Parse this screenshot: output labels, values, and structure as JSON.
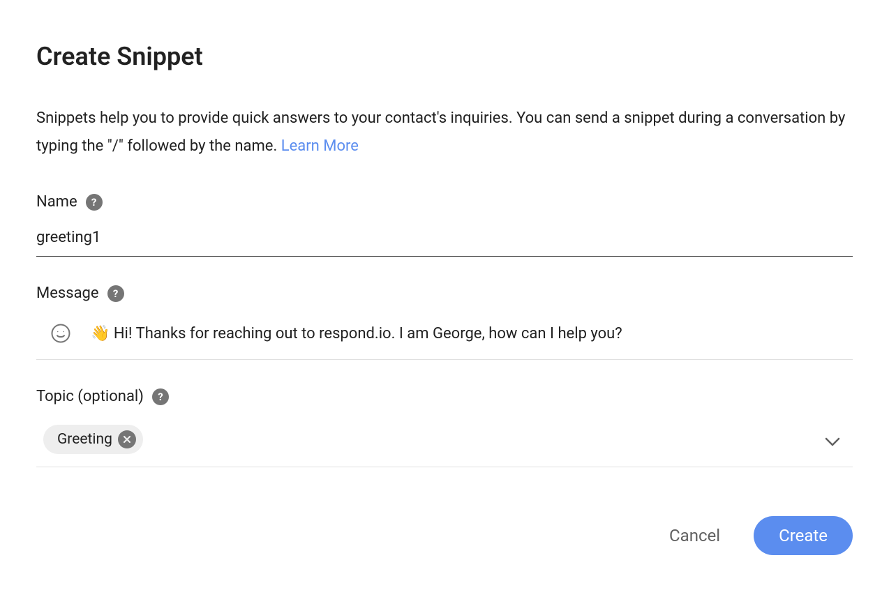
{
  "header": {
    "title": "Create Snippet"
  },
  "description": {
    "text": "Snippets help you to provide quick answers to your contact's inquiries. You can send a snippet during a conversation by typing the \"/\" followed by the name. ",
    "learn_more_label": "Learn More"
  },
  "fields": {
    "name": {
      "label": "Name",
      "value": "greeting1"
    },
    "message": {
      "label": "Message",
      "value": "👋 Hi! Thanks for reaching out to respond.io. I am George, how can I help you?"
    },
    "topic": {
      "label": "Topic (optional)",
      "chips": [
        {
          "label": "Greeting"
        }
      ]
    }
  },
  "actions": {
    "cancel_label": "Cancel",
    "create_label": "Create"
  }
}
